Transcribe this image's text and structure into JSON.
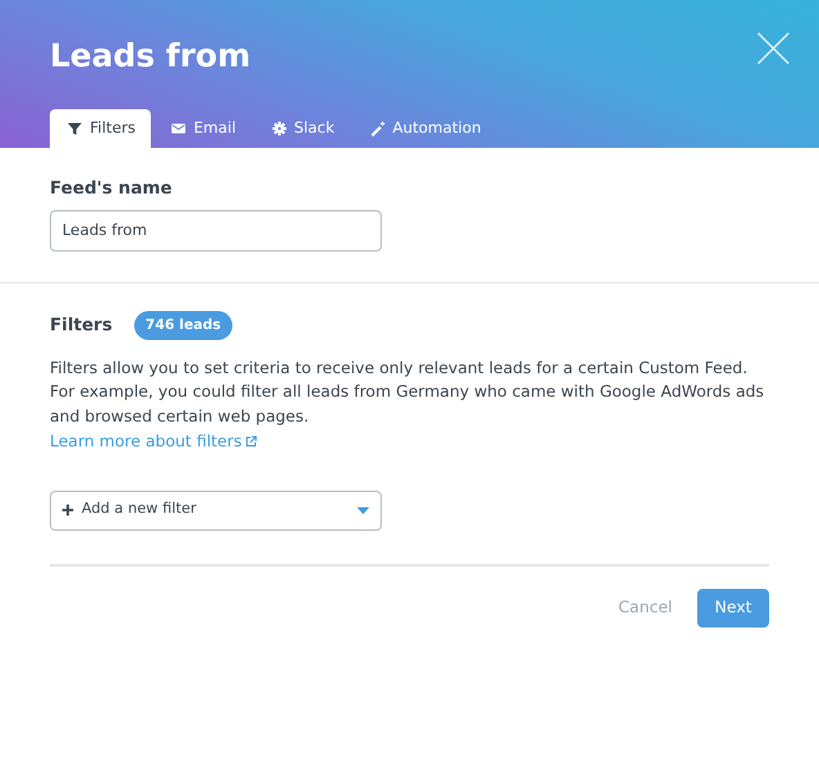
{
  "header": {
    "title": "Leads from"
  },
  "tabs": [
    {
      "label": "Filters",
      "kind": "filter",
      "selected": true
    },
    {
      "label": "Email",
      "kind": "email",
      "selected": false
    },
    {
      "label": "Slack",
      "kind": "slack",
      "selected": false
    },
    {
      "label": "Automation",
      "kind": "automation",
      "selected": false
    }
  ],
  "feed_name": {
    "label": "Feed's name",
    "value": "Leads from"
  },
  "filters": {
    "label": "Filters",
    "badge": "746 leads",
    "description": "Filters allow you to set criteria to receive only relevant leads for a certain Custom Feed. For example, you could filter all leads from Germany who came with Google AdWords ads and browsed certain web pages.",
    "link": "Learn more about filters",
    "dropdown": "Add a new filter"
  },
  "buttons": [
    {
      "label": "Cancel",
      "kind": "secondary"
    },
    {
      "label": "Next",
      "kind": "primary"
    }
  ]
}
